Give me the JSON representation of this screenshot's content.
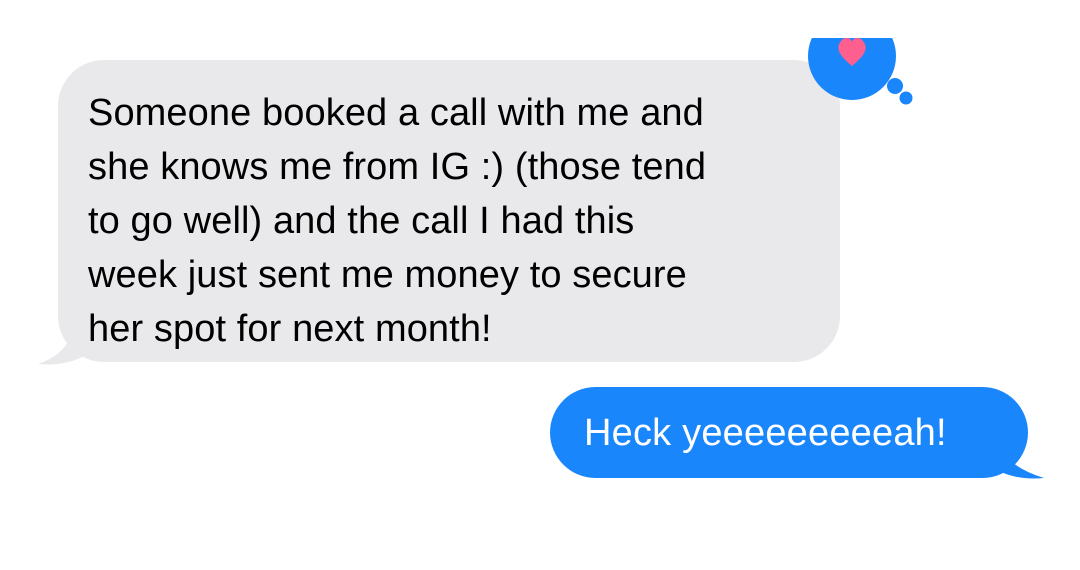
{
  "conversation": {
    "messages": [
      {
        "direction": "received",
        "text": "Someone booked a call with me and\nshe knows me from IG :) (those tend\nto go well) and the call I had this\nweek just sent me money to secure\nher spot for next month!",
        "reaction": "heart-icon"
      },
      {
        "direction": "sent",
        "text": "Heck yeeeeeeeeeah!"
      }
    ]
  },
  "colors": {
    "received_bubble": "#e9e9eb",
    "sent_bubble": "#1a86fb",
    "reaction_bubble": "#1a86fb",
    "heart": "#ff5f8f",
    "background": "#ffffff"
  }
}
